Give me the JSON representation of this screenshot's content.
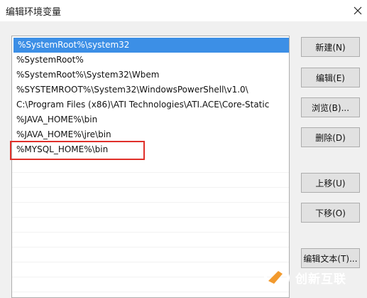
{
  "window": {
    "title": "编辑环境变量"
  },
  "list": {
    "items": [
      "%SystemRoot%\\system32",
      "%SystemRoot%",
      "%SystemRoot%\\System32\\Wbem",
      "%SYSTEMROOT%\\System32\\WindowsPowerShell\\v1.0\\",
      "C:\\Program Files (x86)\\ATI Technologies\\ATI.ACE\\Core-Static",
      "%JAVA_HOME%\\bin",
      "%JAVA_HOME%\\jre\\bin",
      "%MYSQL_HOME%\\bin"
    ],
    "selected_index": 0,
    "highlighted_index": 7
  },
  "buttons": {
    "new": "新建(N)",
    "edit": "编辑(E)",
    "browse": "浏览(B)...",
    "delete": "删除(D)",
    "move_up": "上移(U)",
    "move_down": "下移(O)",
    "edit_text": "编辑文本(T)..."
  },
  "watermark": {
    "text": "创新互联"
  },
  "colors": {
    "selection": "#3c8fe6",
    "annotation": "#e0302a",
    "watermark": "#ffffff"
  }
}
